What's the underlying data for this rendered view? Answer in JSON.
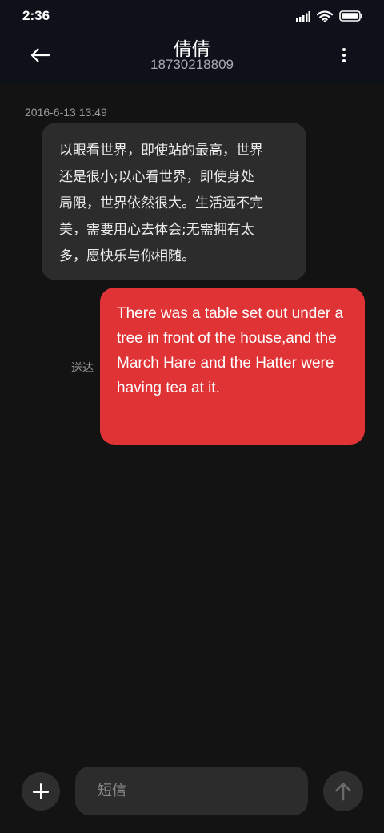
{
  "status_bar": {
    "time": "2:36",
    "icons": [
      "signal-icon",
      "wifi-icon",
      "battery-icon"
    ]
  },
  "header": {
    "contact_name": "倩倩",
    "contact_number": "18730218809",
    "back_icon": "back-arrow-icon",
    "more_icon": "more-vert-icon"
  },
  "conversation": {
    "timestamp": "2016-6-13 13:49",
    "messages": [
      {
        "direction": "incoming",
        "text": "以眼看世界，即使站的最高，世界\n还是很小;以心看世界，即使身处\n局限，世界依然很大。生活远不完\n美，需要用心去体会;无需拥有太\n多，愿快乐与你相随。"
      },
      {
        "direction": "outgoing",
        "text": "There was a table set out under a tree in front of the house,and the March Hare and the Hatter were having tea at it.",
        "status": "送达"
      }
    ]
  },
  "composer": {
    "placeholder": "短信",
    "value": "",
    "add_icon": "plus-icon",
    "send_icon": "arrow-up-icon"
  },
  "colors": {
    "background": "#131313",
    "header": "#0f111a",
    "incoming_bubble": "#2c2c2c",
    "outgoing_bubble": "#e03335"
  }
}
